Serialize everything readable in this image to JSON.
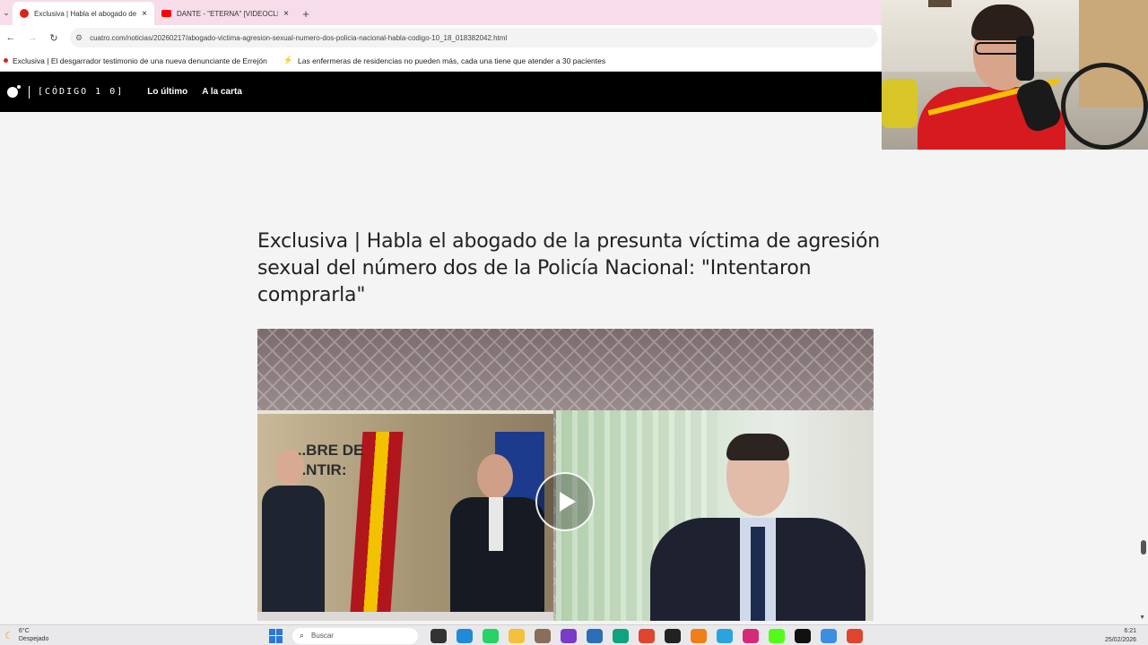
{
  "browser": {
    "tabs": [
      {
        "title": "Exclusiva | Habla el abogado de",
        "active": true
      },
      {
        "title": "DANTE - \"ETERNA\" [VIDEOCLIP",
        "active": false
      }
    ],
    "menu_label": "⌄",
    "new_tab_label": "+",
    "close_label": "×",
    "url": "cuatro.com/noticias/20260217/abogado-victima-agresion-sexual-numero-dos-policia-nacional-habla-codigo-10_18_018382042.html",
    "bookmarks": [
      {
        "label": "Exclusiva | El desgarrador testimonio de una nueva denunciante de Errejón"
      },
      {
        "label": "Las enfermeras de residencias no pueden más, cada una tiene que atender a 30 pacientes"
      }
    ]
  },
  "site": {
    "logo_text": "[CÓDIGO 1 0]",
    "nav": [
      "Lo último",
      "A la carta"
    ]
  },
  "article": {
    "headline": "Exclusiva | Habla el abogado de la presunta víctima de agresión sexual del número dos de la Policía Nacional: \"Intentaron comprarla\"",
    "video_overlay_text": "...BRE DE\n...NTIR:"
  },
  "taskbar": {
    "weather_temp": "6°C",
    "weather_desc": "Despejado",
    "search_placeholder": "Buscar",
    "time": "6:21",
    "date": "25/02/2026",
    "apps": [
      {
        "name": "task-view-icon",
        "color": "#333333"
      },
      {
        "name": "edge-icon",
        "color": "#1f8ad6"
      },
      {
        "name": "whatsapp-icon",
        "color": "#25d366"
      },
      {
        "name": "file-explorer-icon",
        "color": "#f3c13a"
      },
      {
        "name": "app-icon",
        "color": "#8a6d5a"
      },
      {
        "name": "clipchamp-icon",
        "color": "#7a3cc8"
      },
      {
        "name": "store-icon",
        "color": "#2a6fb8"
      },
      {
        "name": "app-green-icon",
        "color": "#10a37f"
      },
      {
        "name": "chrome-icon",
        "color": "#e0452f"
      },
      {
        "name": "media-icon",
        "color": "#222222"
      },
      {
        "name": "rtve-icon",
        "color": "#f07f1a"
      },
      {
        "name": "telegram-icon",
        "color": "#2aa3e0"
      },
      {
        "name": "instagram-icon",
        "color": "#d62976"
      },
      {
        "name": "kick-icon",
        "color": "#53fc18"
      },
      {
        "name": "tiktok-icon",
        "color": "#111111"
      },
      {
        "name": "notepad-icon",
        "color": "#3c8fe0"
      },
      {
        "name": "chrome-alt-icon",
        "color": "#e0452f"
      }
    ]
  }
}
